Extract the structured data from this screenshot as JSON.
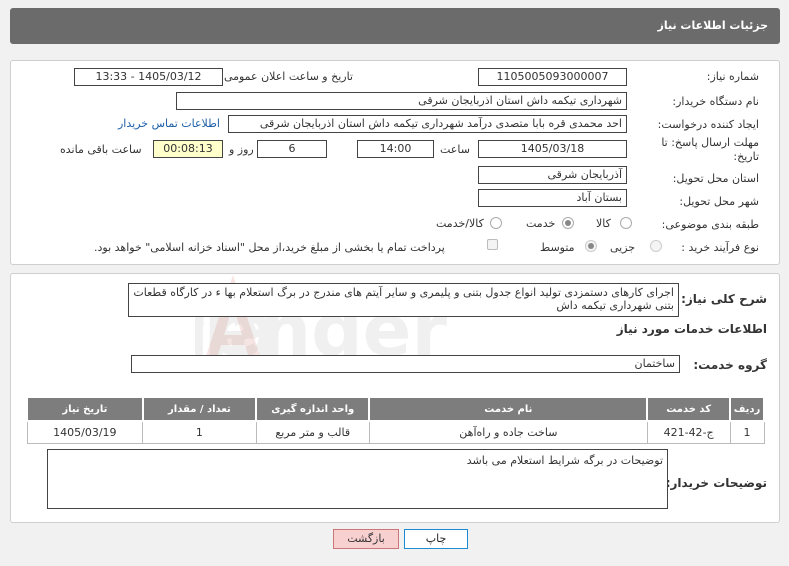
{
  "header": {
    "title": "جزئیات اطلاعات نیاز"
  },
  "need_info": {
    "need_number_label": "شماره نیاز:",
    "need_number": "1105005093000007",
    "announce_label": "تاریخ و ساعت اعلان عمومی:",
    "announce_value": "1405/03/12 - 13:33",
    "buyer_label": "نام دستگاه خریدار:",
    "buyer_value": "شهرداری تیکمه داش استان اذربایجان شرقی",
    "creator_label": "ایجاد کننده درخواست:",
    "creator_value": "احد محمدی قره بابا متصدی درآمد شهرداری تیکمه داش استان اذربایجان شرقی",
    "contact_link": "اطلاعات تماس خریدار",
    "deadline_label": "مهلت ارسال پاسخ: تا تاریخ:",
    "deadline_date": "1405/03/18",
    "time_label": "ساعت",
    "deadline_time": "14:00",
    "days": "6",
    "days_label": "روز و",
    "remaining": "00:08:13",
    "remaining_label": "ساعت باقی مانده",
    "province_label": "استان محل تحویل:",
    "province_value": "آذربایجان شرقی",
    "city_label": "شهر محل تحویل:",
    "city_value": "بستان آباد",
    "category_label": "طبقه بندی موضوعی:",
    "category_options": [
      "کالا",
      "خدمت",
      "کالا/خدمت"
    ],
    "category_selected": "خدمت",
    "process_label": "نوع فرآیند خرید :",
    "process_options": [
      "جزیی",
      "متوسط"
    ],
    "process_selected": "متوسط",
    "payment_note": "پرداخت تمام یا بخشی از مبلغ خرید،از محل \"اسناد خزانه اسلامی\" خواهد بود."
  },
  "description": {
    "label": "شرح کلی نیاز:",
    "text": "اجرای کارهای دستمزدی تولید انواع جدول بتنی و پلیمری و سایر آیتم های مندرج در برگ استعلام بها ء در کارگاه قطعات بتنی شهرداری تیکمه داش"
  },
  "services": {
    "section_title": "اطلاعات خدمات مورد نیاز",
    "group_label": "گروه خدمت:",
    "group_value": "ساختمان",
    "columns": [
      "ردیف",
      "کد خدمت",
      "نام خدمت",
      "واحد اندازه گیری",
      "تعداد / مقدار",
      "تاریخ نیاز"
    ],
    "rows": [
      {
        "row": "1",
        "code": "ج-42-421",
        "name": "ساخت جاده و راه‌آهن",
        "unit": "قالب و متر مربع",
        "qty": "1",
        "date": "1405/03/19"
      }
    ]
  },
  "buyer_notes": {
    "label": "توضیحات خریدار:",
    "text": "توضیحات در برگه شرایط استعلام می باشد"
  },
  "buttons": {
    "print": "چاپ",
    "back": "بازگشت"
  },
  "colors": {
    "header_bg": "#6b6b6b",
    "table_header_bg": "#7d7d7d",
    "link": "#1e5fa8",
    "remaining_bg": "#ffffcc",
    "back_button_bg": "#f9d0d0"
  }
}
